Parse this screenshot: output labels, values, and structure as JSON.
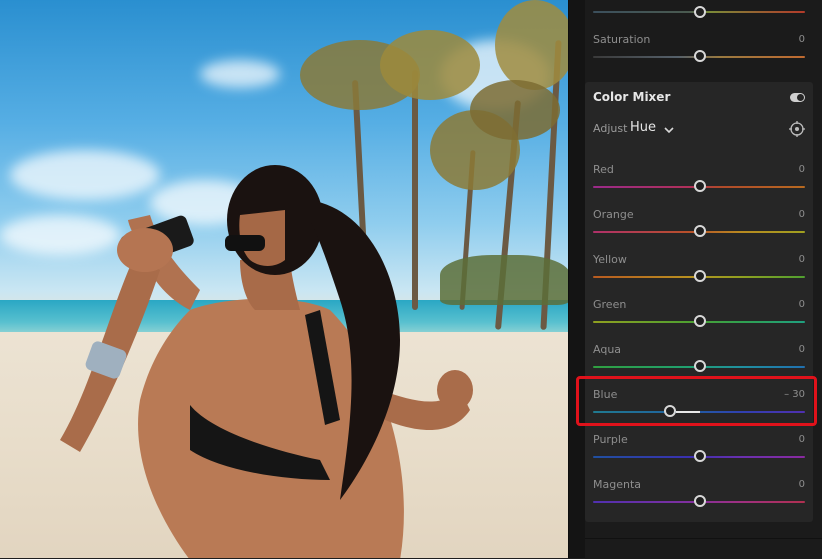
{
  "panel": {
    "top_slider": {
      "label": "",
      "value": ""
    },
    "saturation": {
      "label": "Saturation",
      "value": "0"
    },
    "color_mixer": {
      "title": "Color Mixer",
      "adjust_label": "Adjust",
      "adjust_value": "Hue",
      "toggle_state": "on",
      "sliders": [
        {
          "label": "Red",
          "value": "0"
        },
        {
          "label": "Orange",
          "value": "0"
        },
        {
          "label": "Yellow",
          "value": "0"
        },
        {
          "label": "Green",
          "value": "0"
        },
        {
          "label": "Aqua",
          "value": "0"
        },
        {
          "label": "Blue",
          "value": "– 30"
        },
        {
          "label": "Purple",
          "value": "0"
        },
        {
          "label": "Magenta",
          "value": "0"
        }
      ]
    }
  },
  "colors": {
    "highlight": "#e0121b",
    "panel_bg": "#1b1b1b",
    "card_bg": "#262626"
  },
  "icons": {
    "toggle": "toggle-switch-icon",
    "dropdown": "chevron-down-icon",
    "target": "target-adjust-icon"
  }
}
